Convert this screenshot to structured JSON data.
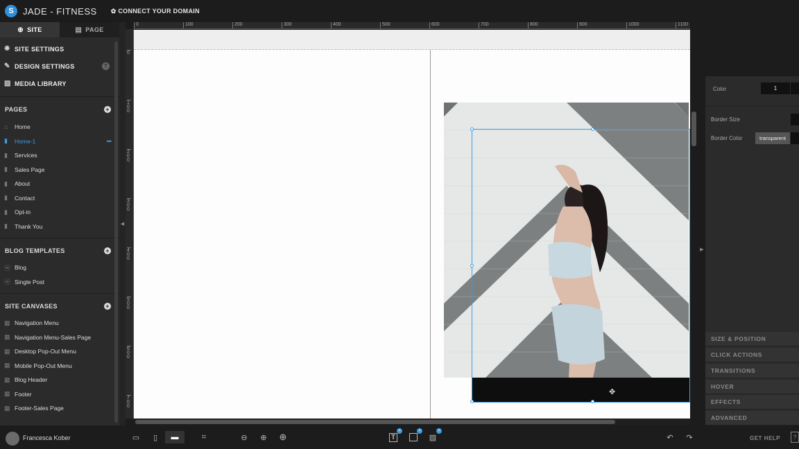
{
  "topbar": {
    "app_title": "JADE - FITNESS",
    "connect_label": "CONNECT YOUR DOMAIN"
  },
  "sidebar": {
    "tabs": [
      {
        "label": "SITE",
        "icon": "globe-icon"
      },
      {
        "label": "PAGE",
        "icon": "page-icon"
      }
    ],
    "settings": [
      {
        "label": "SITE SETTINGS",
        "icon": "gear-icon"
      },
      {
        "label": "DESIGN SETTINGS",
        "icon": "brush-icon"
      },
      {
        "label": "MEDIA LIBRARY",
        "icon": "image-icon"
      }
    ],
    "help_label": "?",
    "pages_header": "PAGES",
    "pages": [
      "Home",
      "Home-1",
      "Services",
      "Sales Page",
      "About",
      "Contact",
      "Opt-in",
      "Thank You"
    ],
    "selected_page": "Home-1",
    "blog_header": "BLOG TEMPLATES",
    "blog_templates": [
      "Blog",
      "Single Post"
    ],
    "canvases_header": "SITE CANVASES",
    "canvases": [
      "Navigation Menu",
      "Navigation Menu-Sales Page",
      "Desktop Pop-Out Menu",
      "Mobile Pop-Out Menu",
      "Blog Header",
      "Footer",
      "Footer-Sales Page"
    ]
  },
  "ruler": {
    "top_ticks": [
      "0",
      "100",
      "200",
      "300",
      "400",
      "500",
      "600",
      "700",
      "800",
      "900",
      "1000",
      "1100"
    ],
    "left_ticks": [
      "0",
      "100",
      "200",
      "300",
      "400",
      "500",
      "600",
      "700"
    ]
  },
  "right_panel": {
    "color_label": "Color",
    "color_value": "1",
    "border_size_label": "Border Size",
    "border_color_label": "Border Color",
    "border_color_value": "transparent",
    "sections": [
      "SIZE & POSITION",
      "CLICK ACTIONS",
      "TRANSITIONS",
      "HOVER",
      "EFFECTS",
      "ADVANCED"
    ]
  },
  "bottombar": {
    "user_name": "Francesca Kober",
    "get_help": "GET HELP",
    "help_q": "?"
  },
  "colors": {
    "accent": "#3c9be0",
    "background": "#1c1c1c",
    "panel": "#2b2b2b"
  }
}
